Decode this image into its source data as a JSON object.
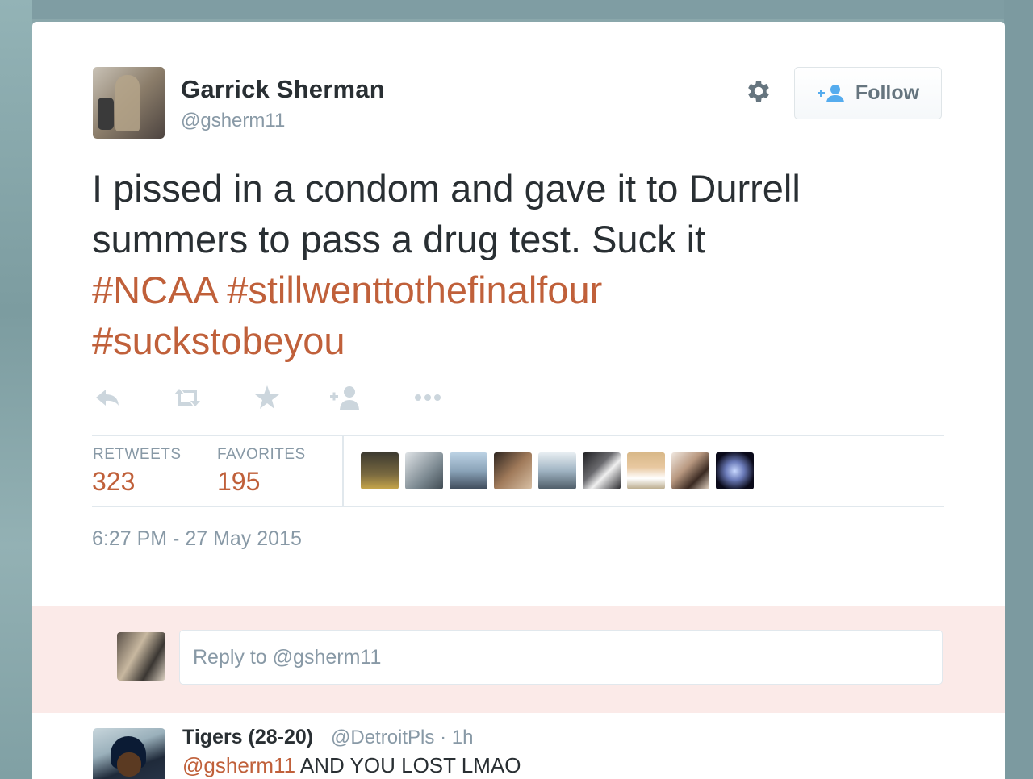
{
  "tweet": {
    "display_name": "Garrick Sherman",
    "handle": "@gsherm11",
    "follow_label": "Follow",
    "text_line1": "I pissed in a condom and gave it to Durrell",
    "text_line2": "summers to pass a drug test. Suck it",
    "hashtag_1": "#NCAA",
    "hashtag_2": "#stillwenttothefinalfour",
    "hashtag_3": "#suckstobeyou",
    "actions": [
      "reply-icon",
      "retweet-icon",
      "favorite-icon",
      "follow-icon",
      "more-icon"
    ],
    "stats": {
      "retweets_label": "RETWEETS",
      "retweets_value": "323",
      "favorites_label": "FAVORITES",
      "favorites_value": "195"
    },
    "favoriter_count": 9,
    "timestamp": "6:27 PM - 27 May 2015"
  },
  "reply_composer": {
    "placeholder": "Reply to @gsherm11"
  },
  "reply": {
    "name": "Tigers (28-20)",
    "handle": "@DetroitPls",
    "separator": "·",
    "time": "1h",
    "mention": "@gsherm11",
    "text": "AND YOU LOST LMAO"
  },
  "colors": {
    "link": "#c0603a",
    "text": "#292f33",
    "muted": "#8899a6",
    "reply_band": "#fbeae8"
  }
}
